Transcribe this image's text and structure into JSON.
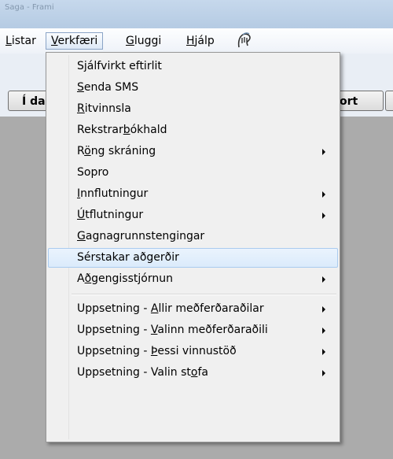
{
  "window": {
    "title": "Saga - Frami"
  },
  "menubar": {
    "items": [
      {
        "id": "listar",
        "label": "Listar",
        "accel": "L",
        "rest": "istar"
      },
      {
        "id": "verkfaeri",
        "label": "Verkfæri",
        "accel": "V",
        "rest": "erkfæri"
      },
      {
        "id": "gluggi",
        "label": "Gluggi",
        "accel": "G",
        "rest": "luggi"
      },
      {
        "id": "hjalp",
        "label": "Hjálp",
        "accel": "H",
        "rest": "jálp"
      }
    ]
  },
  "toolbar": {
    "left_button_label": "Í da",
    "right_button_label": "ort"
  },
  "dropdown": {
    "items": [
      {
        "pre": "",
        "accel": "",
        "post": "Sjálfvirkt eftirlit",
        "submenu": false
      },
      {
        "pre": "",
        "accel": "S",
        "post": "enda SMS",
        "submenu": false
      },
      {
        "pre": "",
        "accel": "R",
        "post": "itvinnsla",
        "submenu": false
      },
      {
        "pre": "Rekstrar",
        "accel": "b",
        "post": "ókhald",
        "submenu": false
      },
      {
        "pre": "R",
        "accel": "ö",
        "post": "ng skráning",
        "submenu": true
      },
      {
        "pre": "",
        "accel": "",
        "post": "Sopro",
        "submenu": false
      },
      {
        "pre": "",
        "accel": "I",
        "post": "nnflutningur",
        "submenu": true
      },
      {
        "pre": "",
        "accel": "Ú",
        "post": "tflutningur",
        "submenu": true
      },
      {
        "pre": "",
        "accel": "G",
        "post": "agnagrunnstengingar",
        "submenu": false
      },
      {
        "pre": "Sérstakar aðgerðir",
        "accel": "",
        "post": "",
        "submenu": false,
        "highlighted": true
      },
      {
        "pre": "A",
        "accel": "ð",
        "post": "gengisstjórnun",
        "submenu": true
      },
      {
        "pre": "Uppsetning - ",
        "accel": "A",
        "post": "llir meðferðaraðilar",
        "submenu": true
      },
      {
        "pre": "Uppsetning - ",
        "accel": "V",
        "post": "alinn meðferðaraðili",
        "submenu": true
      },
      {
        "pre": "Uppsetning - ",
        "accel": "Þ",
        "post": "essi vinnustöð",
        "submenu": true
      },
      {
        "pre": "Uppsetning - Valin st",
        "accel": "o",
        "post": "fa",
        "submenu": true
      }
    ]
  }
}
